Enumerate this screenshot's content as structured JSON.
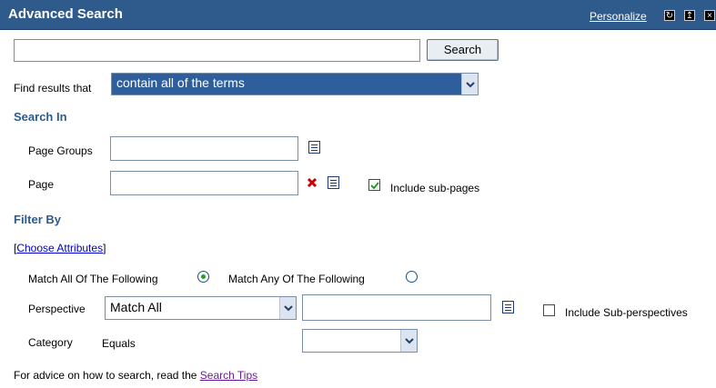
{
  "header": {
    "title": "Advanced Search",
    "personalize": "Personalize"
  },
  "search": {
    "button": "Search",
    "value": ""
  },
  "find_results": {
    "label": "Find results that",
    "selected": "contain all of the terms"
  },
  "search_in": {
    "heading": "Search In",
    "page_groups_label": "Page Groups",
    "page_label": "Page",
    "include_subpages_label": "Include sub-pages",
    "include_subpages_checked": true
  },
  "filter_by": {
    "heading": "Filter By",
    "bracket_open": "[",
    "choose_attributes": "Choose Attributes",
    "bracket_close": "]",
    "match_all_label": "Match All Of The Following",
    "match_any_label": "Match Any Of The Following",
    "match_all_selected": true,
    "perspective_label": "Perspective",
    "perspective_selected": "Match All",
    "include_subperspectives_label": "Include Sub-perspectives",
    "category_label": "Category",
    "category_operator": "Equals",
    "category_selected": ""
  },
  "advice": {
    "text": "For advice on how to search, read the ",
    "link": "Search Tips"
  },
  "colors": {
    "header_bg": "#2f5a8c",
    "section_heading": "#2c5b8f",
    "checkmark": "#21a121",
    "remove_icon": "#cc0000"
  }
}
